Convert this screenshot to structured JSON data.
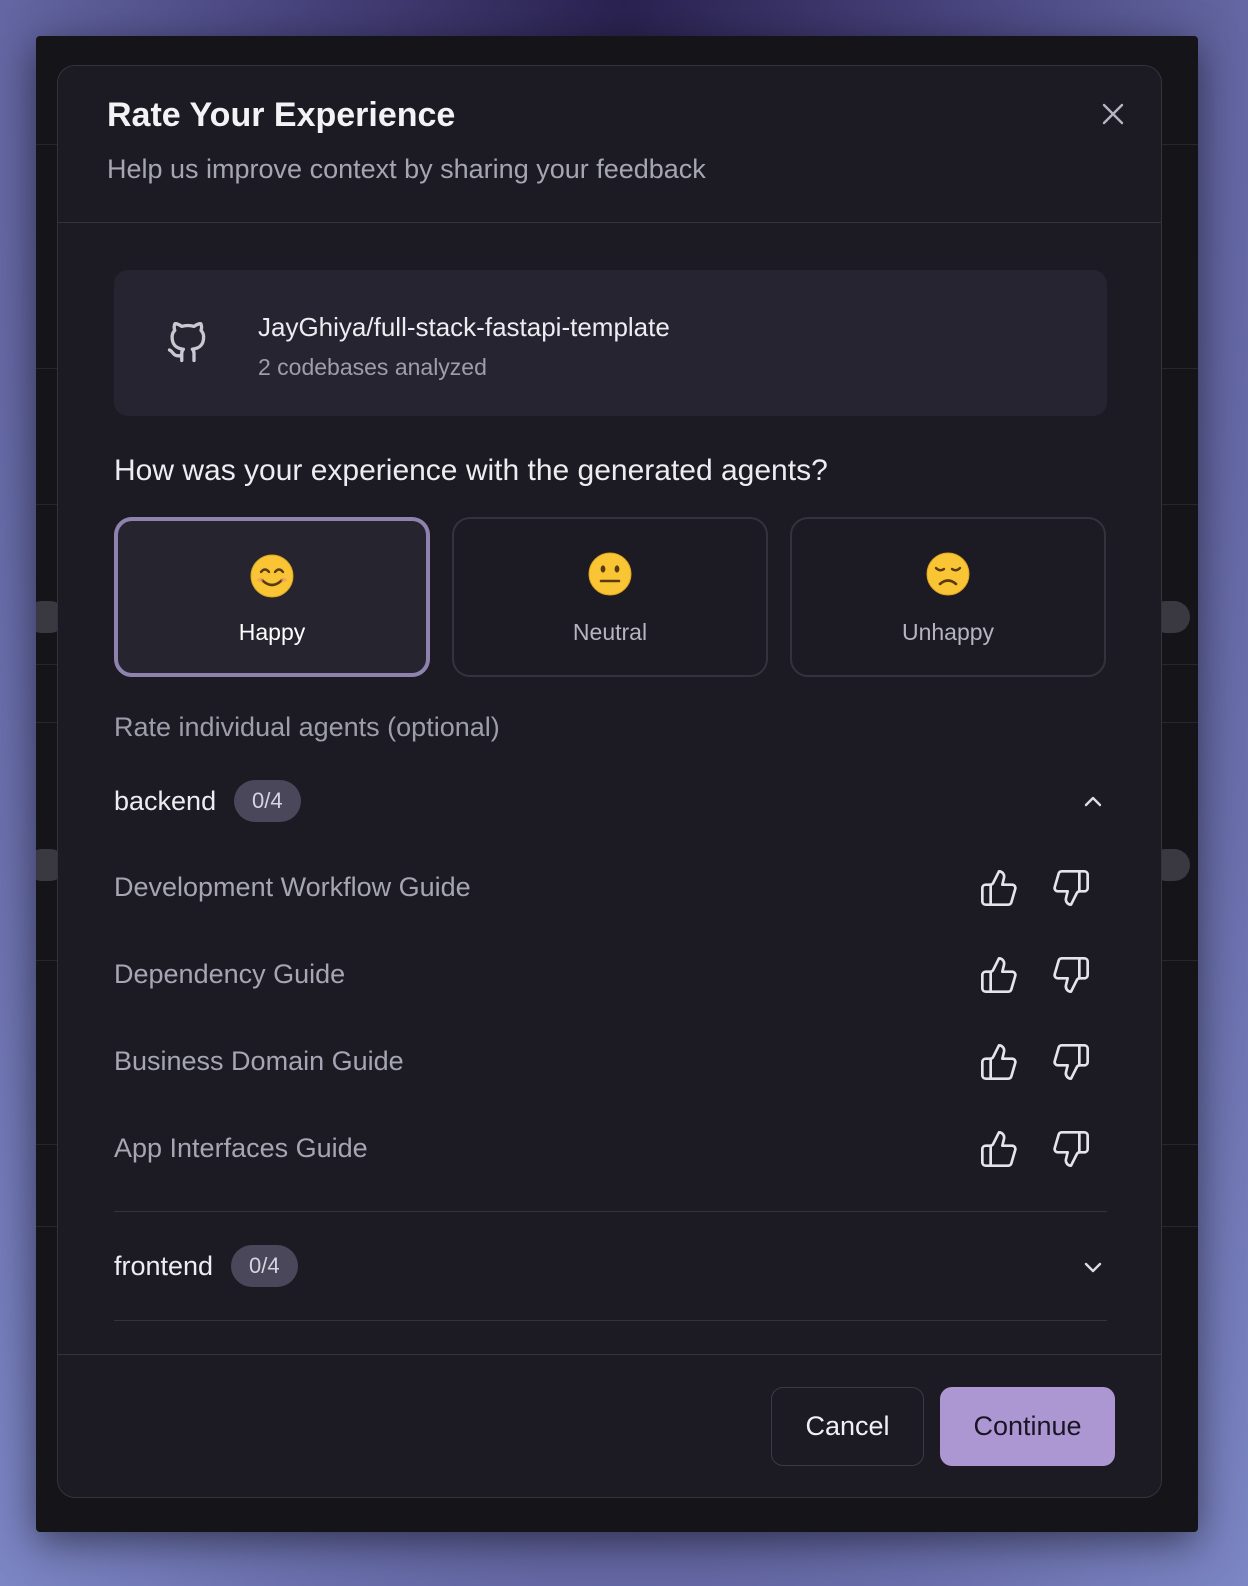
{
  "modal": {
    "title": "Rate Your Experience",
    "subtitle": "Help us improve context by sharing your feedback"
  },
  "repo": {
    "name": "JayGhiya/full-stack-fastapi-template",
    "meta": "2 codebases analyzed",
    "icon": "github-icon"
  },
  "question": "How was your experience with the generated agents?",
  "moods": [
    {
      "label": "Happy",
      "emoji": "smiling-face",
      "selected": true
    },
    {
      "label": "Neutral",
      "emoji": "neutral-face",
      "selected": false
    },
    {
      "label": "Unhappy",
      "emoji": "disappointed-face",
      "selected": false
    }
  ],
  "individual_label": "Rate individual agents (optional)",
  "groups": [
    {
      "name": "backend",
      "count": "0/4",
      "expanded": true,
      "agents": [
        {
          "name": "Development Workflow Guide"
        },
        {
          "name": "Dependency Guide"
        },
        {
          "name": "Business Domain Guide"
        },
        {
          "name": "App Interfaces Guide"
        }
      ]
    },
    {
      "name": "frontend",
      "count": "0/4",
      "expanded": false,
      "agents": []
    }
  ],
  "footer": {
    "cancel_label": "Cancel",
    "continue_label": "Continue"
  },
  "colors": {
    "accent": "#ad97d3",
    "selected_border": "#8f82ae",
    "modal_bg": "#1c1b24"
  }
}
